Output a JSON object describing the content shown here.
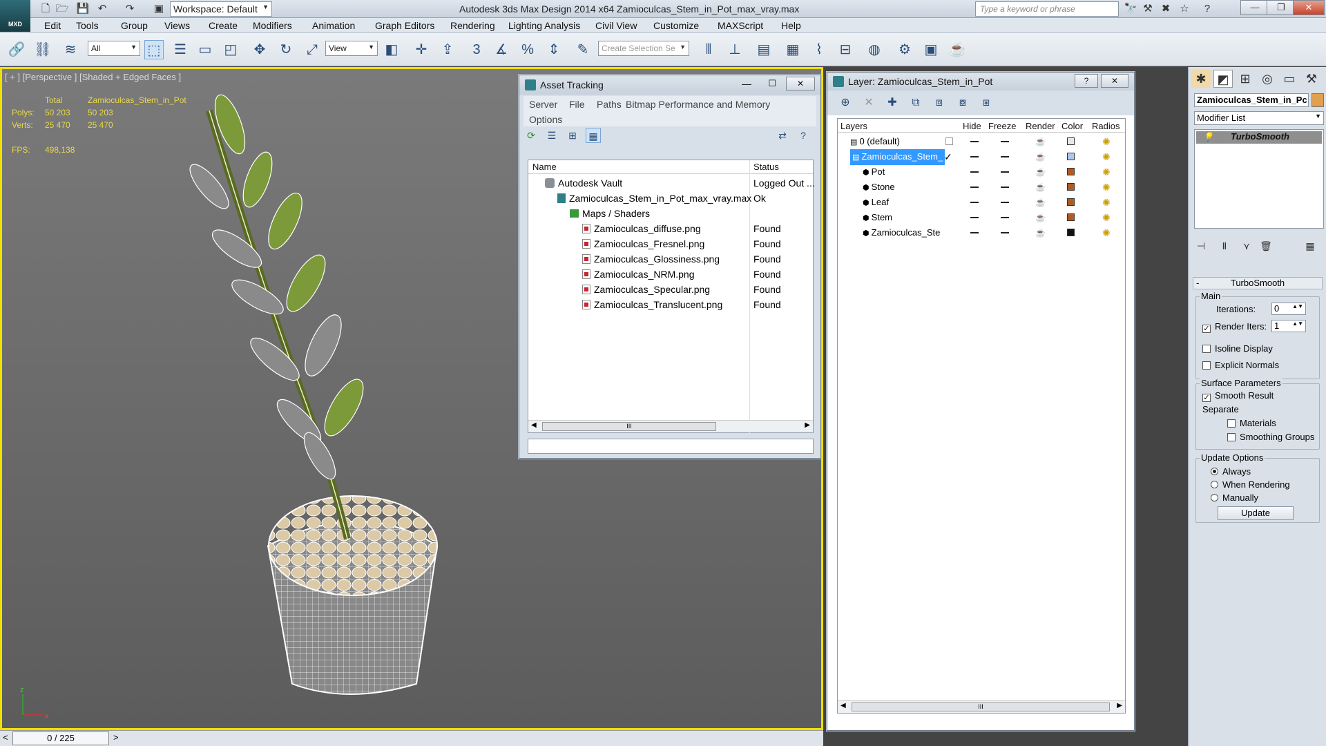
{
  "app": {
    "logo": "MXD",
    "title": "Autodesk 3ds Max Design 2014 x64    Zamioculcas_Stem_in_Pot_max_vray.max",
    "workspace": "Workspace: Default",
    "search_placeholder": "Type a keyword or phrase"
  },
  "menu": [
    "Edit",
    "Tools",
    "Group",
    "Views",
    "Create",
    "Modifiers",
    "Animation",
    "Graph Editors",
    "Rendering",
    "Lighting Analysis",
    "Civil View",
    "Customize",
    "MAXScript",
    "Help"
  ],
  "toolbar": {
    "filter_value": "All",
    "refcoord_value": "View",
    "selection_set_placeholder": "Create Selection Se",
    "snap_label": "3"
  },
  "viewport": {
    "label": "[ + ] [Perspective ] [Shaded + Edged Faces ]",
    "stats": {
      "col_total": "Total",
      "col_object": "Zamioculcas_Stem_in_Pot",
      "polys_label": "Polys:",
      "polys_total": "50 203",
      "polys_obj": "50 203",
      "verts_label": "Verts:",
      "verts_total": "25 470",
      "verts_obj": "25 470",
      "fps_label": "FPS:",
      "fps_value": "498,138"
    },
    "axis_z": "z",
    "axis_x": "x"
  },
  "timeline": {
    "frame": "0 / 225",
    "prev": "<",
    "next": ">"
  },
  "asset_tracking": {
    "title": "Asset Tracking",
    "menus": [
      "Server",
      "File",
      "Paths",
      "Bitmap Performance and Memory"
    ],
    "menu_options": "Options",
    "col_name": "Name",
    "col_status": "Status",
    "rows": [
      {
        "name": "Autodesk Vault",
        "status": "Logged Out ...",
        "indent": 0,
        "icon": "vault"
      },
      {
        "name": "Zamioculcas_Stem_in_Pot_max_vray.max",
        "status": "Ok",
        "indent": 1,
        "icon": "max"
      },
      {
        "name": "Maps / Shaders",
        "status": "",
        "indent": 2,
        "icon": "folder"
      },
      {
        "name": "Zamioculcas_diffuse.png",
        "status": "Found",
        "indent": 3,
        "icon": "file"
      },
      {
        "name": "Zamioculcas_Fresnel.png",
        "status": "Found",
        "indent": 3,
        "icon": "file"
      },
      {
        "name": "Zamioculcas_Glossiness.png",
        "status": "Found",
        "indent": 3,
        "icon": "file"
      },
      {
        "name": "Zamioculcas_NRM.png",
        "status": "Found",
        "indent": 3,
        "icon": "file"
      },
      {
        "name": "Zamioculcas_Specular.png",
        "status": "Found",
        "indent": 3,
        "icon": "file"
      },
      {
        "name": "Zamioculcas_Translucent.png",
        "status": "Found",
        "indent": 3,
        "icon": "file"
      }
    ],
    "scroll_grip": "III"
  },
  "layer_dialog": {
    "title": "Layer: Zamioculcas_Stem_in_Pot",
    "help": "?",
    "close": "✕",
    "cols": {
      "layers": "Layers",
      "hide": "Hide",
      "freeze": "Freeze",
      "render": "Render",
      "color": "Color",
      "radios": "Radios"
    },
    "rows": [
      {
        "name": "0 (default)",
        "indent": 0,
        "color": "#e8e8e8",
        "selected": false,
        "kind": "layer"
      },
      {
        "name": "Zamioculcas_Stem_",
        "indent": 0,
        "color": "#a9c8ee",
        "selected": true,
        "kind": "layer"
      },
      {
        "name": "Pot",
        "indent": 1,
        "color": "#b35a1f",
        "selected": false,
        "kind": "object"
      },
      {
        "name": "Stone",
        "indent": 1,
        "color": "#b35a1f",
        "selected": false,
        "kind": "object"
      },
      {
        "name": "Leaf",
        "indent": 1,
        "color": "#b35a1f",
        "selected": false,
        "kind": "object"
      },
      {
        "name": "Stem",
        "indent": 1,
        "color": "#b35a1f",
        "selected": false,
        "kind": "object"
      },
      {
        "name": "Zamioculcas_Ste",
        "indent": 1,
        "color": "#111111",
        "selected": false,
        "kind": "object"
      }
    ],
    "check": "✓",
    "scroll_grip": "III"
  },
  "command_panel": {
    "object_name": "Zamioculcas_Stem_in_Pc",
    "modifier_list": "Modifier List",
    "modifier": "TurboSmooth",
    "rollout_title": "TurboSmooth",
    "rollout_toggle": "-",
    "main_group": "Main",
    "iterations_label": "Iterations:",
    "iterations_value": "0",
    "render_iters_label": "Render Iters:",
    "render_iters_value": "1",
    "isoline": "Isoline Display",
    "explicit_normals": "Explicit Normals",
    "surface_group": "Surface Parameters",
    "smooth_result": "Smooth Result",
    "separate": "Separate",
    "materials": "Materials",
    "smoothing_groups": "Smoothing Groups",
    "update_group": "Update Options",
    "always": "Always",
    "when_rendering": "When Rendering",
    "manually": "Manually",
    "update_btn": "Update"
  },
  "colors": {
    "viewport_border": "#f0e000",
    "stats": "#e8d84a",
    "selection": "#3399ff"
  }
}
